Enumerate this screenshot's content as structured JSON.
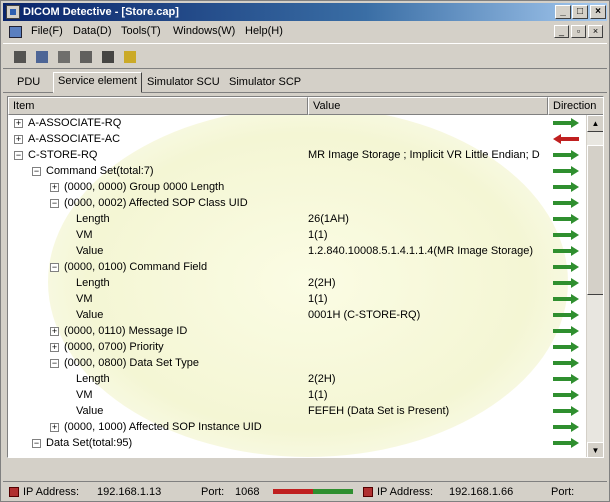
{
  "window": {
    "title": "DICOM Detective - [Store.cap]"
  },
  "menu": [
    "File(F)",
    "Data(D)",
    "Tools(T)",
    "Windows(W)",
    "Help(H)"
  ],
  "toolbar": {
    "tools": [
      {
        "name": "open-icon",
        "color": "#333333"
      },
      {
        "name": "save-icon",
        "color": "#2a4a8a"
      },
      {
        "name": "document-icon",
        "color": "#555555"
      },
      {
        "name": "connect-icon",
        "color": "#444444"
      },
      {
        "name": "arrow-icon",
        "color": "#222222"
      },
      {
        "name": "help-icon",
        "color": "#c8a000"
      }
    ]
  },
  "tabs": [
    "PDU",
    "Service element",
    "Simulator SCU",
    "Simulator SCP"
  ],
  "table": {
    "columns": [
      "Item",
      "Value",
      "Direction"
    ],
    "rows": [
      {
        "label": "A-ASSOCIATE-RQ",
        "value": "",
        "indent": 0,
        "exp": "+",
        "dir": "green"
      },
      {
        "label": "A-ASSOCIATE-AC",
        "value": "",
        "indent": 0,
        "exp": "+",
        "dir": "red"
      },
      {
        "label": "C-STORE-RQ",
        "value": "MR Image Storage ; Implicit VR Little Endian; D",
        "indent": 0,
        "exp": "-",
        "dir": "green"
      },
      {
        "label": "Command Set(total:7)",
        "value": "",
        "indent": 1,
        "exp": "-",
        "dir": "green"
      },
      {
        "label": "(0000, 0000) Group 0000 Length",
        "value": "",
        "indent": 2,
        "exp": "+",
        "dir": "green"
      },
      {
        "label": "(0000, 0002) Affected SOP Class UID",
        "value": "",
        "indent": 2,
        "exp": "-",
        "dir": "green"
      },
      {
        "label": "Length",
        "value": "26(1AH)",
        "indent": 3,
        "exp": "",
        "dir": "green"
      },
      {
        "label": "VM",
        "value": "1(1)",
        "indent": 3,
        "exp": "",
        "dir": "green"
      },
      {
        "label": "Value",
        "value": "1.2.840.10008.5.1.4.1.1.4(MR Image Storage)",
        "indent": 3,
        "exp": "",
        "dir": "green"
      },
      {
        "label": "(0000, 0100) Command Field",
        "value": "",
        "indent": 2,
        "exp": "-",
        "dir": "green"
      },
      {
        "label": "Length",
        "value": "2(2H)",
        "indent": 3,
        "exp": "",
        "dir": "green"
      },
      {
        "label": "VM",
        "value": "1(1)",
        "indent": 3,
        "exp": "",
        "dir": "green"
      },
      {
        "label": "Value",
        "value": "0001H (C-STORE-RQ)",
        "indent": 3,
        "exp": "",
        "dir": "green"
      },
      {
        "label": "(0000, 0110) Message ID",
        "value": "",
        "indent": 2,
        "exp": "+",
        "dir": "green"
      },
      {
        "label": "(0000, 0700) Priority",
        "value": "",
        "indent": 2,
        "exp": "+",
        "dir": "green"
      },
      {
        "label": "(0000, 0800) Data Set Type",
        "value": "",
        "indent": 2,
        "exp": "-",
        "dir": "green"
      },
      {
        "label": "Length",
        "value": "2(2H)",
        "indent": 3,
        "exp": "",
        "dir": "green"
      },
      {
        "label": "VM",
        "value": "1(1)",
        "indent": 3,
        "exp": "",
        "dir": "green"
      },
      {
        "label": "Value",
        "value": "FEFEH (Data Set is Present)",
        "indent": 3,
        "exp": "",
        "dir": "green"
      },
      {
        "label": "(0000, 1000) Affected SOP Instance UID",
        "value": "",
        "indent": 2,
        "exp": "+",
        "dir": "green"
      },
      {
        "label": "Data Set(total:95)",
        "value": "",
        "indent": 1,
        "exp": "-",
        "dir": "green"
      }
    ]
  },
  "colors": {
    "dir_green": "#2f8f2f",
    "dir_red": "#c02020"
  },
  "status": {
    "left_label": "IP Address:",
    "left_ip": "192.168.1.13",
    "port_label": "Port:",
    "port": "1068",
    "right_label": "IP Address:",
    "right_ip": "192.168.1.66",
    "right_port_label": "Port:"
  }
}
